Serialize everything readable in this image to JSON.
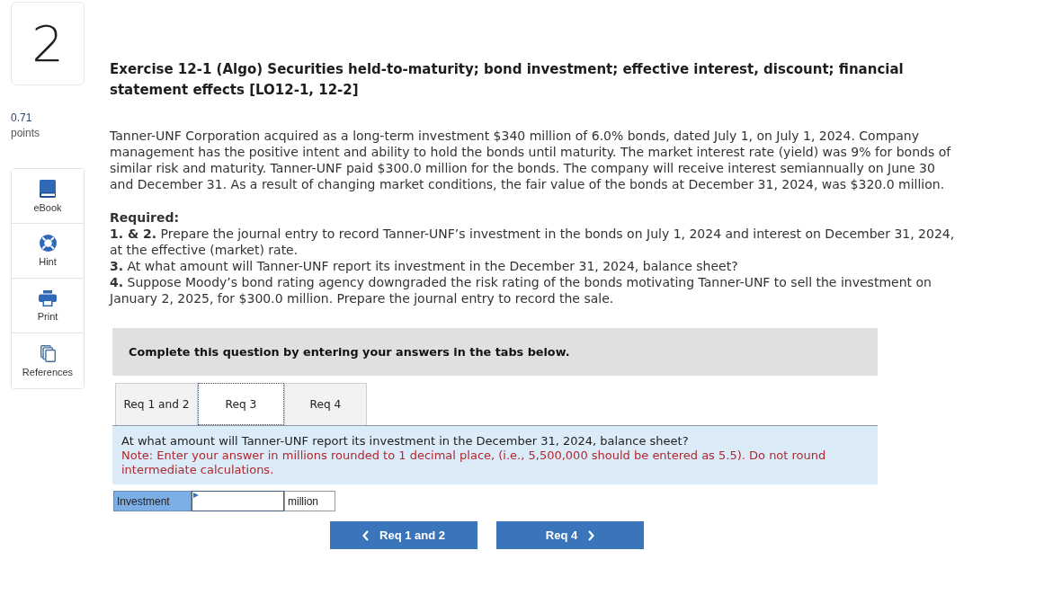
{
  "question_number": "2",
  "score": {
    "value": "0.71",
    "unit": "points"
  },
  "tools": [
    {
      "label": "eBook",
      "kind": "ebook"
    },
    {
      "label": "Hint",
      "kind": "hint"
    },
    {
      "label": "Print",
      "kind": "print"
    },
    {
      "label": "References",
      "kind": "references"
    }
  ],
  "title": "Exercise 12-1 (Algo) Securities held-to-maturity; bond investment; effective interest, discount; financial statement effects [LO12-1, 12-2]",
  "problem_text": "Tanner-UNF Corporation acquired as a long-term investment $340 million of 6.0% bonds, dated July 1, on July 1, 2024. Company management has the positive intent and ability to hold the bonds until maturity. The market interest rate (yield) was 9% for bonds of similar risk and maturity. Tanner-UNF paid $300.0 million for the bonds. The company will receive interest semiannually on June 30 and December 31. As a result of changing market conditions, the fair value of the bonds at December 31, 2024, was $320.0 million.",
  "required": {
    "heading": "Required:",
    "items": [
      "**1. & 2.** Prepare the journal entry to record Tanner-UNF’s investment in the bonds on July 1, 2024 and interest on December 31, 2024, at the effective (market) rate.",
      "**3.** At what amount will Tanner-UNF report its investment in the December 31, 2024, balance sheet?",
      "**4.** Suppose Moody’s bond rating agency downgraded the risk rating of the bonds motivating Tanner-UNF to sell the investment on January 2, 2025, for $300.0 million. Prepare the journal entry to record the sale."
    ]
  },
  "instructions_banner": "Complete this question by entering your answers in the tabs below.",
  "tabs": [
    {
      "label": "Req 1 and 2",
      "selected": false
    },
    {
      "label": "Req 3",
      "selected": true
    },
    {
      "label": "Req 4",
      "selected": false
    }
  ],
  "question": {
    "prompt": "At what amount will Tanner-UNF report its investment in the December 31, 2024, balance sheet?",
    "note": "Note: Enter your answer in millions rounded to 1 decimal place, (i.e., 5,500,000 should be entered as 5.5). Do not round intermediate calculations."
  },
  "answer_row": {
    "label": "Investment",
    "unit": "million"
  },
  "nav_buttons": [
    {
      "label": "Req 1 and 2",
      "kind": "previous"
    },
    {
      "label": "Req 4",
      "kind": "next"
    }
  ]
}
